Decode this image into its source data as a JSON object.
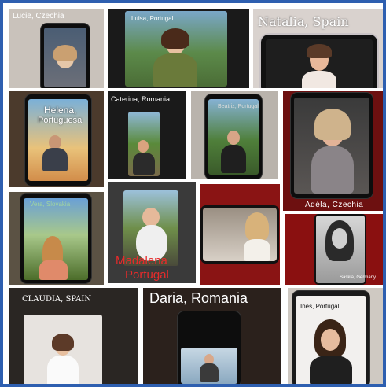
{
  "collage": {
    "captions": {
      "lucie": "Lucie, Czechia",
      "luisa": "Luisa, Portugal",
      "natalia": "Natalia, Spain",
      "helena_line1": "Helena,",
      "helena_line2": "Portuguesa",
      "caterina": "Caterina, Romania",
      "beatriz": "Beatriz, Portugal",
      "adela": "Adéla, Czechia",
      "vera": "Vera, Slovakia",
      "madalena_line1": "Madalena",
      "madalena_line2": "Portugal",
      "saskia": "Saskia, Germany",
      "claudia": "CLAUDIA, SPAIN",
      "daria": "Daria, Romania",
      "ines": "Inês, Portugal"
    }
  }
}
